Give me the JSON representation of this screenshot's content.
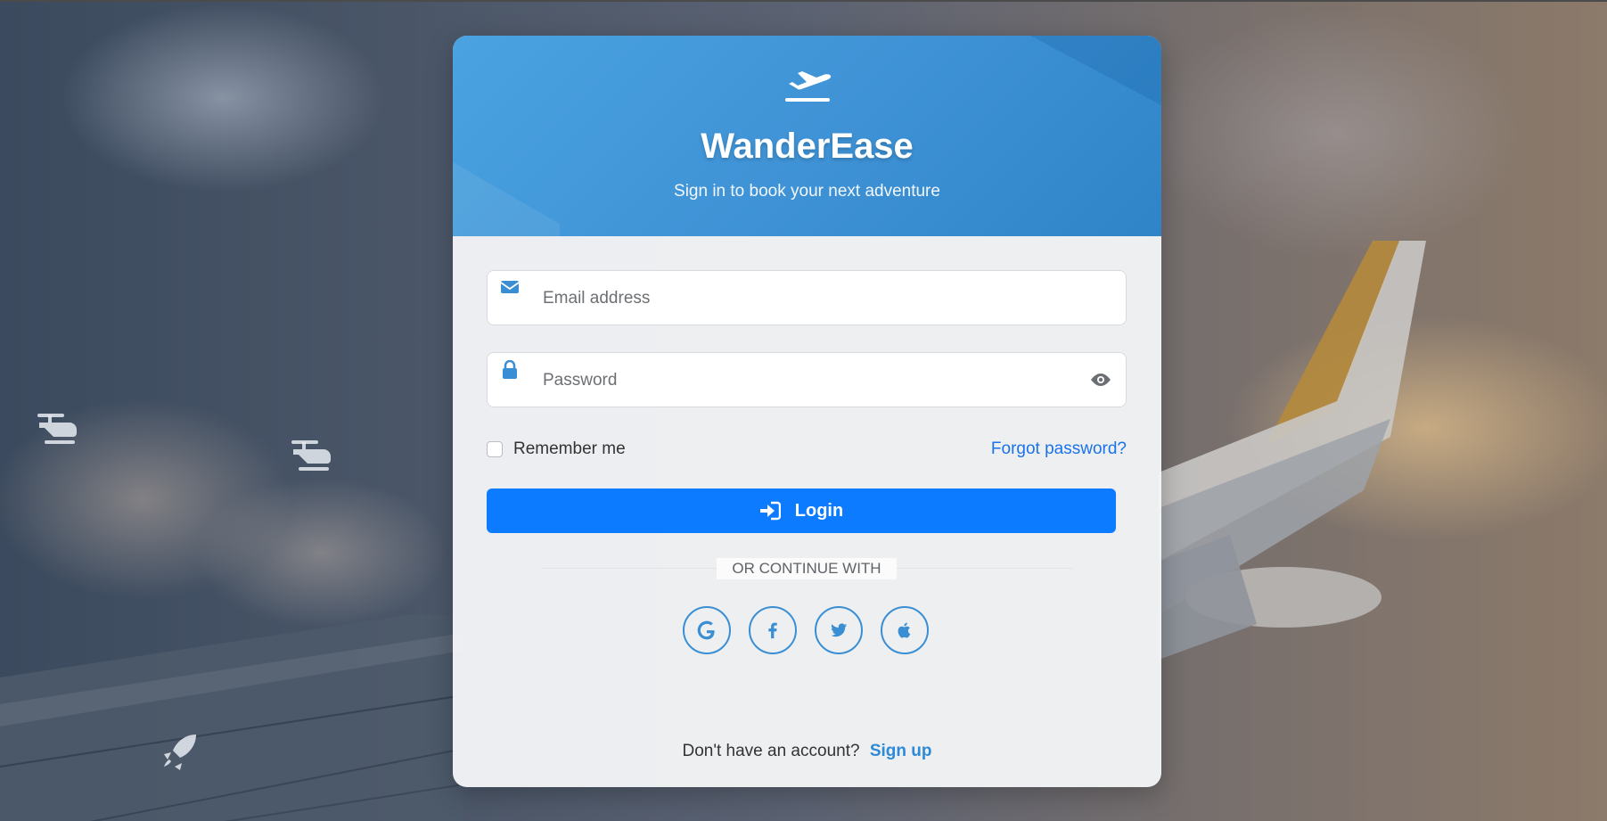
{
  "brand": {
    "name": "WanderEase",
    "tagline": "Sign in to book your next adventure",
    "logo_icon": "plane-departure-icon"
  },
  "form": {
    "email_placeholder": "Email address",
    "email_value": "",
    "email_icon": "envelope-icon",
    "password_placeholder": "Password",
    "password_value": "",
    "password_icon": "lock-icon",
    "password_toggle_icon": "eye-icon",
    "remember_label": "Remember me",
    "remember_checked": false,
    "forgot_label": "Forgot password?",
    "login_label": "Login",
    "login_icon": "sign-in-icon"
  },
  "divider": {
    "label": "OR CONTINUE WITH"
  },
  "social": [
    {
      "provider": "google",
      "icon": "google-icon"
    },
    {
      "provider": "facebook",
      "icon": "facebook-icon"
    },
    {
      "provider": "twitter",
      "icon": "twitter-icon"
    },
    {
      "provider": "apple",
      "icon": "apple-icon"
    }
  ],
  "signup": {
    "prompt": "Don't have an account?",
    "link_label": "Sign up"
  },
  "background_icons": [
    "helicopter-icon",
    "helicopter-icon",
    "rocket-icon"
  ],
  "colors": {
    "header_blue": "#4aa3e0",
    "primary_button": "#0d7bff",
    "link_blue": "#1a73e8",
    "social_blue": "#3a8fd4"
  }
}
